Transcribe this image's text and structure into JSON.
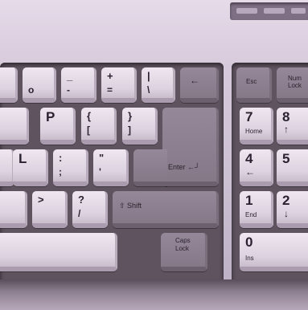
{
  "keyboard": {
    "keys": {
      "o_key": "o",
      "underscore_top": "_",
      "hyphen_bot": "-",
      "plus_top": "+",
      "equals_bot": "=",
      "pipe_top": "|",
      "backslash_bot": "\\",
      "backspace_arrow": "←",
      "p_key": "P",
      "brace_open_top": "{",
      "bracket_open_bot": "[",
      "brace_close_top": "}",
      "bracket_close_bot": "]",
      "l_key": "L",
      "colon_top": ":",
      "semicolon_bot": ";",
      "quote_top": "\"",
      "apostrophe_bot": "'",
      "enter_label": "Enter ←┘",
      "greater_top": ">",
      "question_top": "?",
      "slash_bot": "/",
      "shift_label": "⇧ Shift",
      "caps_lock_label_line1": "Caps",
      "caps_lock_label_line2": "Lock"
    },
    "numpad": {
      "esc_label": "Esc",
      "num_lock_line1": "Num",
      "num_lock_line2": "Lock",
      "seven": "7",
      "home": "Home",
      "eight": "8",
      "up_arrow": "↑",
      "four": "4",
      "left_arrow": "←",
      "five": "5",
      "one": "1",
      "end": "End",
      "two": "2",
      "down_arrow": "↓",
      "zero": "0",
      "ins": "Ins"
    }
  }
}
